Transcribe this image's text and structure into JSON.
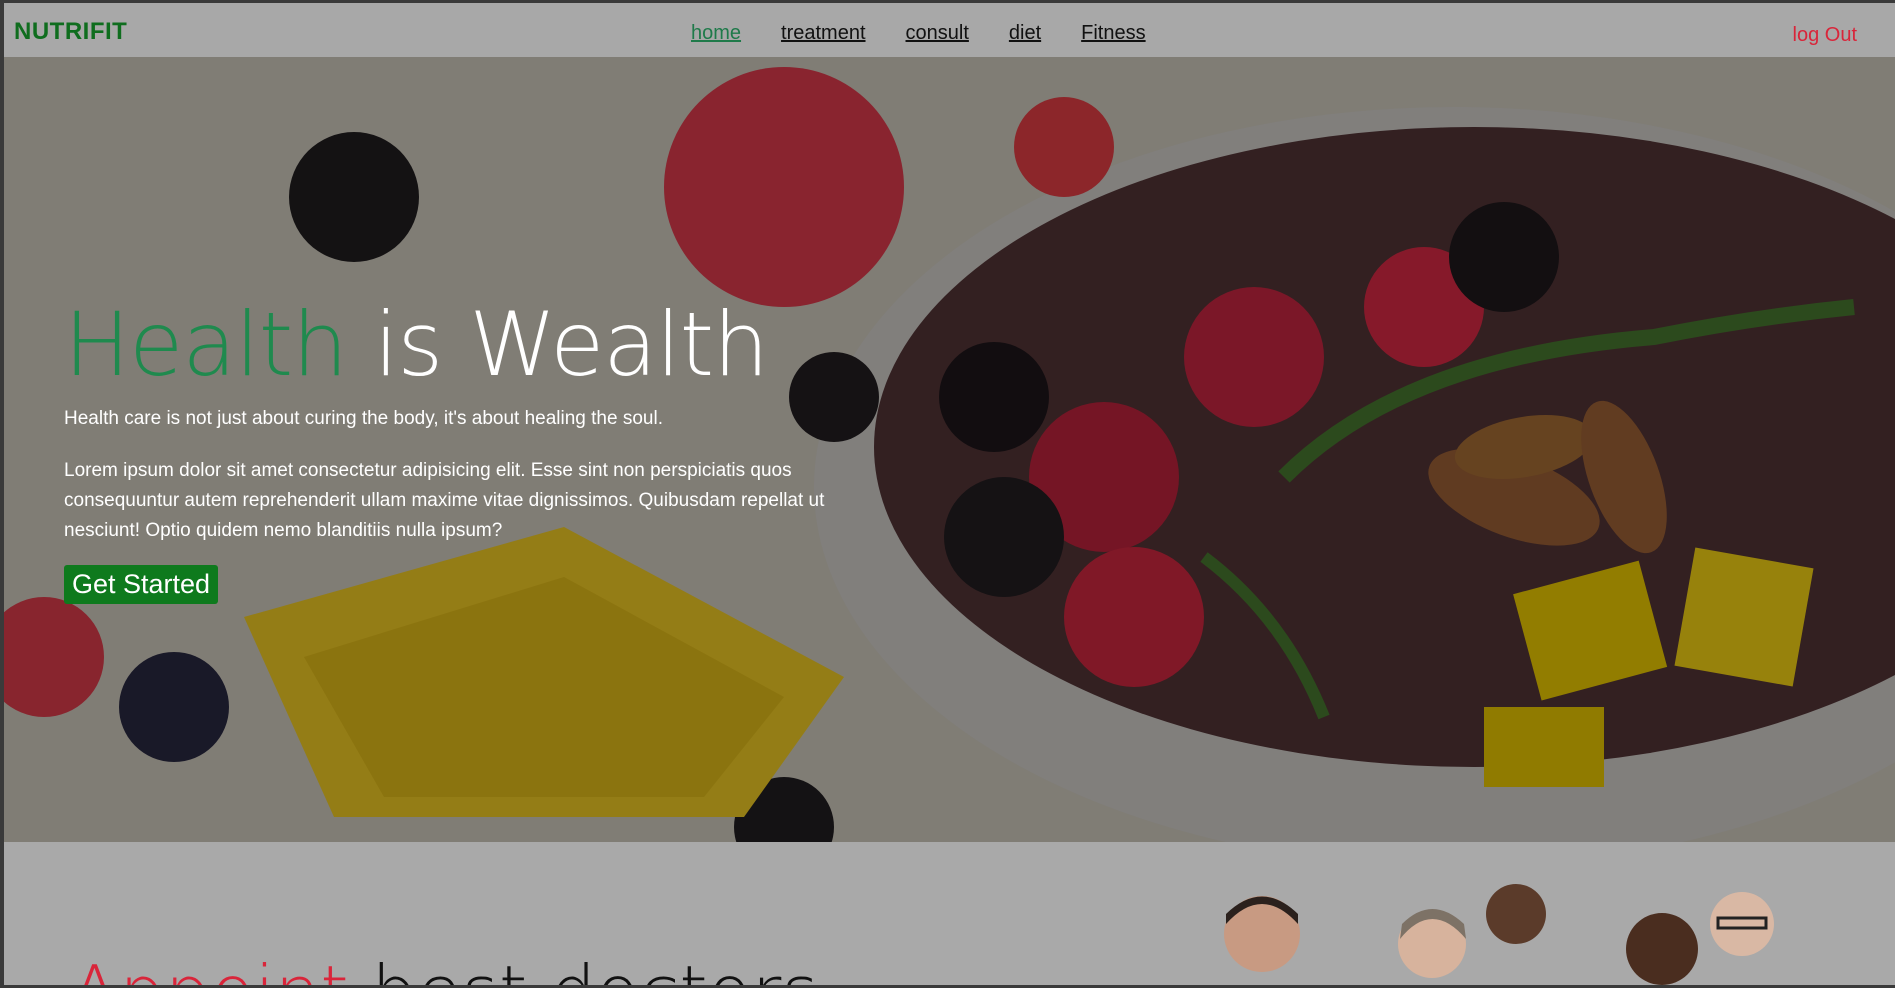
{
  "brand": "NUTRIFIT",
  "nav": {
    "links": [
      {
        "label": "home",
        "active": true
      },
      {
        "label": "treatment",
        "active": false
      },
      {
        "label": "consult",
        "active": false
      },
      {
        "label": "diet",
        "active": false
      },
      {
        "label": "Fitness",
        "active": false
      }
    ],
    "logout": "log Out"
  },
  "hero": {
    "title_accent": "Health",
    "title_rest": " is Wealth",
    "tagline": "Health care is not just about curing the body, it's about healing the soul.",
    "body": "Lorem ipsum dolor sit amet consectetur adipisicing elit. Esse sint non perspiciatis quos consequuntur autem reprehenderit ullam maxime vitae dignissimos. Quibusdam repellat ut nesciunt! Optio quidem nemo blanditiis nulla ipsum?",
    "cta": "Get Started"
  },
  "section2": {
    "title_accent": "Appoint",
    "title_rest": " best doctors"
  },
  "colors": {
    "brand_green": "#0f6d1e",
    "accent_green": "#1f8a4e",
    "logout_red": "#d9253a",
    "cta_green": "#0e7a1d"
  }
}
